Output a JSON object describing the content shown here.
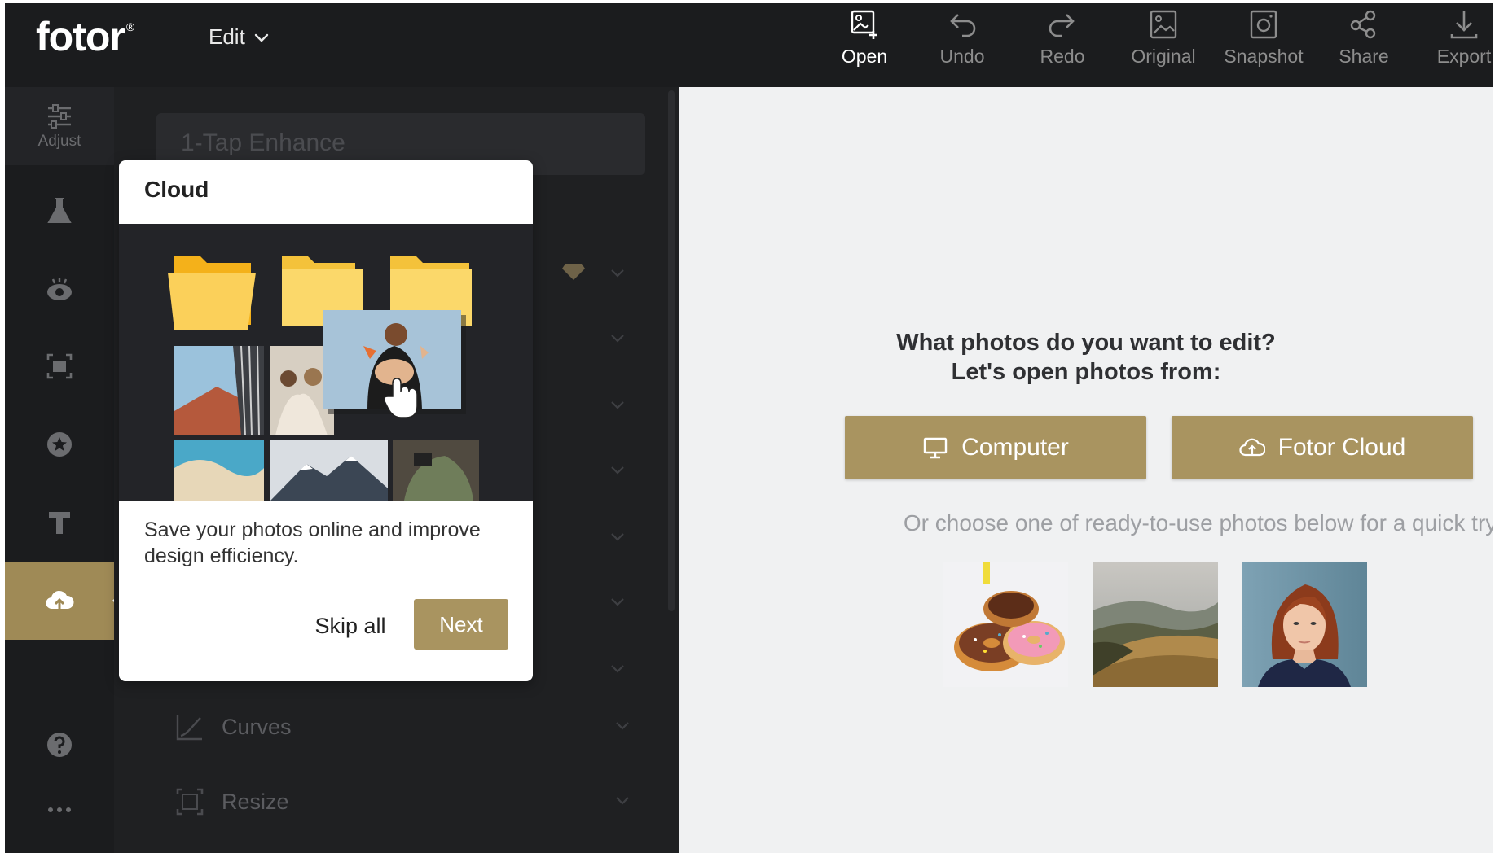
{
  "app": {
    "logo": "fotor",
    "logo_mark": "®",
    "edit_menu": "Edit"
  },
  "toolbar": [
    {
      "key": "open",
      "label": "Open",
      "icon": "open-image-icon",
      "active": true
    },
    {
      "key": "undo",
      "label": "Undo",
      "icon": "undo-icon",
      "active": false
    },
    {
      "key": "redo",
      "label": "Redo",
      "icon": "redo-icon",
      "active": false
    },
    {
      "key": "original",
      "label": "Original",
      "icon": "original-image-icon",
      "active": false
    },
    {
      "key": "snapshot",
      "label": "Snapshot",
      "icon": "snapshot-icon",
      "active": false
    },
    {
      "key": "share",
      "label": "Share",
      "icon": "share-icon",
      "active": false
    },
    {
      "key": "export",
      "label": "Export",
      "icon": "export-icon",
      "active": false
    }
  ],
  "rail": {
    "adjust_label": "Adjust",
    "items": [
      "adjust-icon",
      "effects-flask-icon",
      "beauty-eye-icon",
      "frame-icon",
      "sticker-star-icon",
      "text-icon",
      "cloud-upload-icon",
      "help-icon",
      "more-icon"
    ]
  },
  "panel": {
    "enhance_label": "1-Tap Enhance",
    "rows": [
      {
        "label": "Curves",
        "icon": "curves-icon"
      },
      {
        "label": "Resize",
        "icon": "resize-icon"
      }
    ]
  },
  "tour": {
    "title": "Cloud",
    "description": "Save your photos online and improve design efficiency.",
    "skip_label": "Skip all",
    "next_label": "Next"
  },
  "canvas": {
    "prompt_line1": "What photos do you want to edit?",
    "prompt_line2": "Let's open photos from:",
    "computer_label": "Computer",
    "cloud_label": "Fotor Cloud",
    "or_text": "Or choose one of ready-to-use photos below for a quick try."
  },
  "colors": {
    "accent": "#a99460",
    "dark": "#1e1f21",
    "canvas": "#f0f1f2"
  }
}
